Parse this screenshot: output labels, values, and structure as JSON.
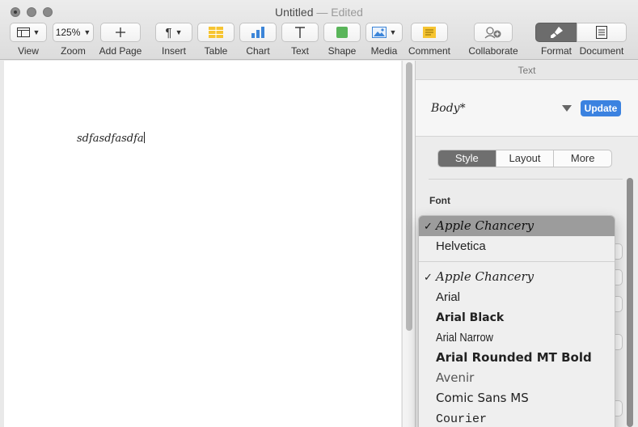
{
  "window": {
    "title": "Untitled",
    "title_suffix": "— Edited"
  },
  "toolbar": {
    "view_label": "View",
    "zoom_value": "125%",
    "zoom_label": "Zoom",
    "add_page_label": "Add Page",
    "insert_label": "Insert",
    "table_label": "Table",
    "chart_label": "Chart",
    "text_label": "Text",
    "shape_label": "Shape",
    "media_label": "Media",
    "comment_label": "Comment",
    "collaborate_label": "Collaborate",
    "format_label": "Format",
    "document_label": "Document"
  },
  "document": {
    "body_text": "sdfasdfasdfa"
  },
  "inspector": {
    "header": "Text",
    "paragraph_style": "Body*",
    "update_label": "Update",
    "tabs": [
      "Style",
      "Layout",
      "More"
    ],
    "active_tab": "Style",
    "font_section_label": "Font"
  },
  "font_menu": {
    "recent": [
      {
        "name": "Apple Chancery",
        "checked": "✓",
        "highlighted": true
      },
      {
        "name": "Helvetica",
        "checked": "",
        "highlighted": false
      }
    ],
    "all": [
      {
        "name": "Apple Chancery",
        "checked": "✓"
      },
      {
        "name": "Arial",
        "checked": ""
      },
      {
        "name": "Arial Black",
        "checked": ""
      },
      {
        "name": "Arial Narrow",
        "checked": ""
      },
      {
        "name": "Arial Rounded MT Bold",
        "checked": ""
      },
      {
        "name": "Avenir",
        "checked": ""
      },
      {
        "name": "Comic Sans MS",
        "checked": ""
      },
      {
        "name": "Courier",
        "checked": ""
      }
    ]
  },
  "colors": {
    "accent": "#3b82e0",
    "highlight": "#9c9c9c",
    "active_segment": "#6f6f6f"
  }
}
